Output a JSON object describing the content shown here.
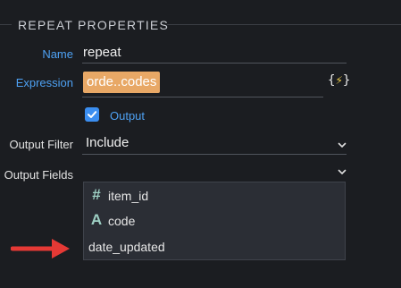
{
  "section": {
    "title": "REPEAT PROPERTIES"
  },
  "name_field": {
    "label": "Name",
    "value": "repeat"
  },
  "expression_field": {
    "label": "Expression",
    "value": "orde..codes",
    "action_label_open": "{",
    "action_label_close": "}"
  },
  "output_checkbox": {
    "label": "Output",
    "checked": true
  },
  "output_filter": {
    "label": "Output Filter",
    "value": "Include"
  },
  "output_fields": {
    "label": "Output Fields",
    "value": "",
    "options": [
      {
        "icon": "hash-icon",
        "glyph": "#",
        "label": "item_id"
      },
      {
        "icon": "text-type-icon",
        "glyph": "A",
        "label": "code"
      },
      {
        "icon": "",
        "glyph": "",
        "label": "date_updated"
      }
    ]
  },
  "colors": {
    "background": "#1b1d21",
    "link_blue": "#4ea1f3",
    "chip_orange": "#e8a866",
    "checkbox_blue": "#3b8ef0",
    "arrow_red": "#e53935",
    "dropdown_bg": "#2b2e35"
  }
}
